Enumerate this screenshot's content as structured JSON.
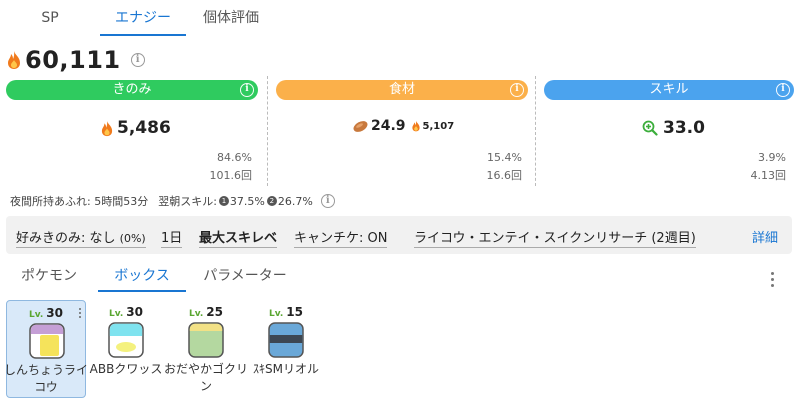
{
  "tabs": [
    {
      "label": "SP",
      "active": false
    },
    {
      "label": "エナジー",
      "active": true
    },
    {
      "label": "個体評価",
      "active": false
    }
  ],
  "total_energy": {
    "value": "60,111",
    "icon": "flame-icon",
    "info_icon": "info-icon"
  },
  "columns": {
    "berry": {
      "label": "きのみ",
      "color": "#2fcb5f",
      "value": "5,486",
      "icon": "flame-icon",
      "percent": "84.6%",
      "count": "101.6回"
    },
    "ingredient": {
      "label": "食材",
      "color": "#fbb04a",
      "value": "24.9",
      "icon": "bean-icon",
      "sub_value": "5,107",
      "sub_icon": "flame-icon",
      "percent": "15.4%",
      "count": "16.6回"
    },
    "skill": {
      "label": "スキル",
      "color": "#4ba3ee",
      "value": "33.0",
      "icon": "magnifier-plus-icon",
      "percent": "3.9%",
      "count": "4.13回"
    }
  },
  "night": {
    "label": "夜間所持あふれ: 5時間53分",
    "next_skill_label": "翌朝スキル: ",
    "skill1_num": "1",
    "skill1_pct": "37.5%",
    "skill2_num": "2",
    "skill2_pct": "26.7%"
  },
  "settings": {
    "favorite_berry": "好みきのみ: なし",
    "favorite_berry_pct": "(0%)",
    "period": "1日",
    "skill_level": "最大スキレベ",
    "candy": "キャンチケ: ON",
    "event": "ライコウ・エンテイ・スイクンリサーチ (2週目)",
    "detail": "詳細"
  },
  "tabs2": [
    {
      "label": "ポケモン",
      "active": false
    },
    {
      "label": "ボックス",
      "active": true
    },
    {
      "label": "パラメーター",
      "active": false
    }
  ],
  "lv_prefix": "Lv.",
  "cards": [
    {
      "level": "30",
      "name": "しんちょうライコウ",
      "selected": true,
      "icon_top": "#c59fd6",
      "icon_bottom": "#f5e35b"
    },
    {
      "level": "30",
      "name": "ABBクワッス",
      "selected": false,
      "icon_top": "#7fe3ef",
      "icon_bottom": "#f4f17e"
    },
    {
      "level": "25",
      "name": "おだやかゴクリン",
      "selected": false,
      "icon_top": "#f2e186",
      "icon_bottom": "#b4d8a0"
    },
    {
      "level": "15",
      "name": "ｽｷSMリオル",
      "selected": false,
      "icon_top": "#6aa8d8",
      "icon_bottom": "#3d4752"
    }
  ]
}
